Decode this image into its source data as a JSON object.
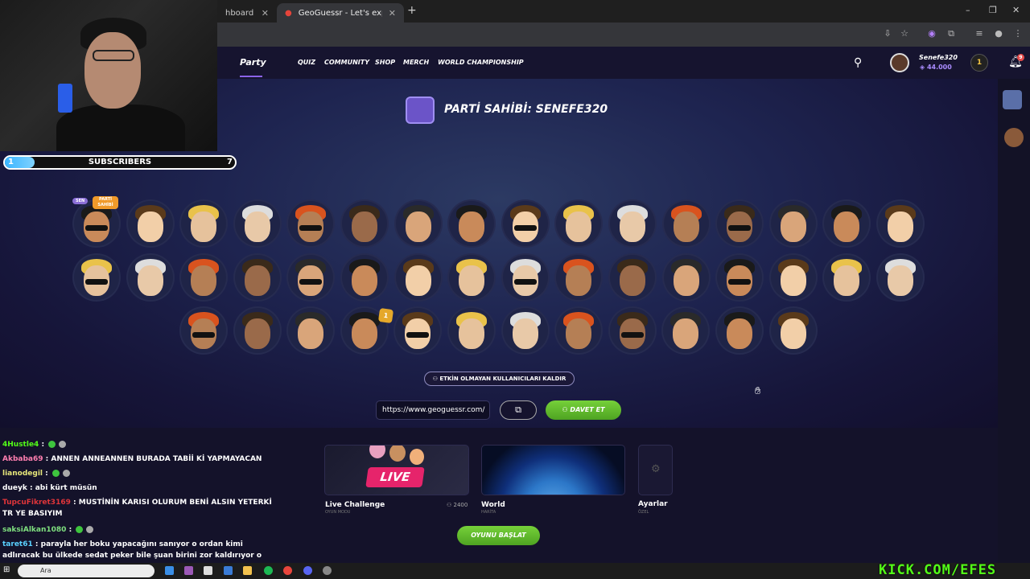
{
  "browser": {
    "tabs": [
      {
        "title": "hboard",
        "active": false
      },
      {
        "title": "GeoGuessr - Let's explore the w",
        "active": true
      }
    ],
    "new_tab": "+",
    "window_controls": [
      "–",
      "❐",
      "✕"
    ]
  },
  "overlay": {
    "sub_goal": {
      "label": "SUBSCRIBERS",
      "current": "1",
      "goal": "7"
    },
    "kick_tag": "KICK.COM/EFES"
  },
  "nav": {
    "links": [
      "QUIZ",
      "COMMUNITY",
      "SHOP",
      "MERCH",
      "WORLD CHAMPIONSHIP"
    ],
    "party": "Party",
    "user": {
      "name": "Senefe320",
      "coins": "44.000",
      "level": "1"
    },
    "notifications": "9"
  },
  "lobby": {
    "host_title": "PARTİ SAHİBİ: SENEFE320",
    "you_badge": "SEN",
    "host_badge": "PARTİ SAHİBİ",
    "gold_badge": "1",
    "kick_inactive": "ETKİN OLMAYAN KULLANICILARI KALDIR",
    "invite_url": "https://www.geoguessr.com/",
    "invite_button": "DAVET ET",
    "start_button": "OYUNU BAŞLAT"
  },
  "modes": [
    {
      "title": "Live Challenge",
      "sub": "OYUN MODU",
      "badge": "LIVE",
      "count": "2400"
    },
    {
      "title": "World",
      "sub": "HARİTA"
    },
    {
      "title": "Ayarlar",
      "sub": "ÖZEL"
    }
  ],
  "chat": [
    {
      "user": "4Hustle4",
      "color": "#53fc18",
      "msg": ""
    },
    {
      "user": "Akbaba69",
      "color": "#ff7fb0",
      "msg": "ANNEN ANNEANNEN BURADA TABİİ Kİ YAPMAYACAN"
    },
    {
      "user": "lianodegil",
      "color": "#e5e57a",
      "msg": ""
    },
    {
      "user": "dueyk",
      "color": "#ffffff",
      "msg": "abi kürt müsün"
    },
    {
      "user": "TupcuFikret3169",
      "color": "#e0353a",
      "msg": "MUSTİNİN KARISI OLURUM BENİ ALSIN YETERKİ TR YE BASIYIM"
    },
    {
      "user": "saksiAlkan1080",
      "color": "#7fe07f",
      "msg": ""
    },
    {
      "user": "taret61",
      "color": "#5ad0ff",
      "msg": "parayla her boku yapacağını sanıyor o ordan kimi adlıracak bu ülkede sedat peker bile şuan birini zor kaldırıyor o kim"
    }
  ],
  "taskbar": {
    "search_placeholder": "Ara"
  },
  "colors": {
    "accent": "#8b63e8",
    "green": "#5bbf2a",
    "kick": "#53fc18"
  }
}
